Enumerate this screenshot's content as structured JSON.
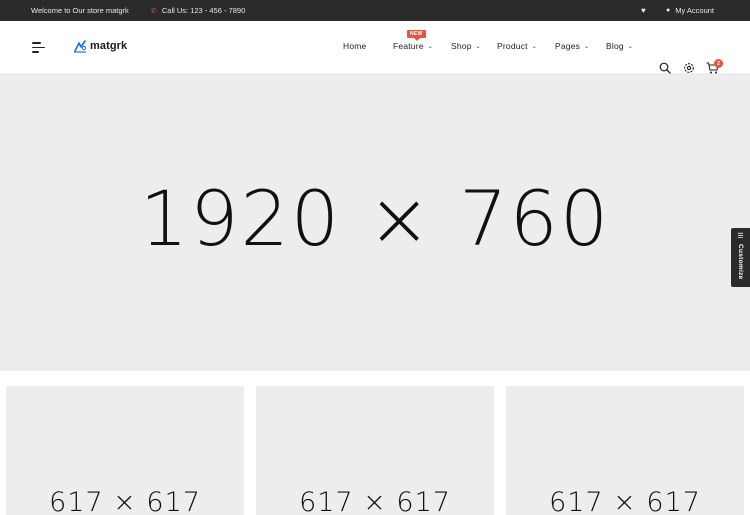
{
  "topbar": {
    "welcome": "Welcome to Our store matgrk",
    "call": "Call Us: 123 - 456 - 7890",
    "account": "My Account"
  },
  "header": {
    "logo": "matgrk",
    "nav": [
      {
        "label": "Home"
      },
      {
        "label": "Feature",
        "badge": "NEW"
      },
      {
        "label": "Shop"
      },
      {
        "label": "Product"
      },
      {
        "label": "Pages"
      },
      {
        "label": "Blog"
      }
    ],
    "cart_count": "2"
  },
  "hero": {
    "placeholder": "1920 × 760"
  },
  "customize": {
    "label": "Customize"
  },
  "tiles": [
    {
      "placeholder": "617 × 617"
    },
    {
      "placeholder": "617 × 617"
    },
    {
      "placeholder": "617 × 617"
    }
  ],
  "colors": {
    "topbar_bg": "#2b2b2b",
    "accent": "#e8553e",
    "placeholder_bg": "#ededed"
  }
}
